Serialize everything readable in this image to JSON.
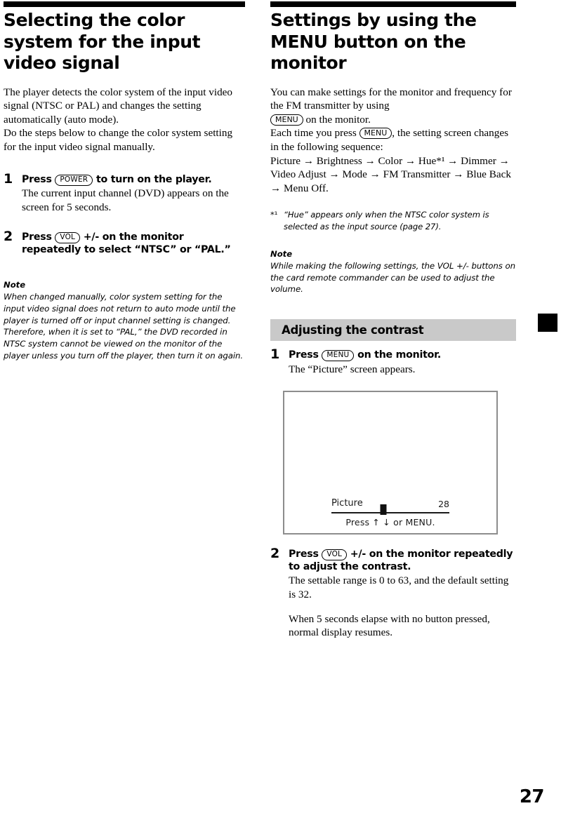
{
  "page": {
    "folio": "27"
  },
  "left_column": {
    "heading": "Selecting the color system for the input video signal",
    "intro": "The player detects the color system of the input video signal (NTSC or PAL) and changes the setting automatically (auto mode).\nDo the steps below to change the color system setting for the input video signal manually.",
    "steps": [
      {
        "number": "1",
        "title_before": "Press",
        "key": "POWER",
        "title_after": "to turn on the player.",
        "description": "The current input channel (DVD) appears on the screen for 5 seconds."
      },
      {
        "number": "2",
        "title_before": "Press",
        "key": "VOL",
        "title_after": "+/- on the monitor repeatedly to select “NTSC” or “PAL.”",
        "description": ""
      }
    ],
    "note": {
      "title": "Note",
      "body": "When changed manually, color system setting for the input video signal does not return to auto mode until the player is turned off or input channel setting is changed. Therefore, when it is set to “PAL,” the DVD recorded in NTSC system cannot be viewed on the monitor of the player unless you turn off the player, then turn it on again."
    }
  },
  "right_column": {
    "heading": "Settings by using the MENU button on the monitor",
    "intro_line1": "You can make settings for the monitor and frequency for the FM transmitter by using",
    "intro_key": "MENU",
    "intro_line2": "on the monitor.",
    "sequence_lead1": "Each time you press",
    "sequence_key": "MENU",
    "sequence_lead2": ", the setting screen changes in the following sequence:",
    "sequence": [
      "Picture",
      "Brightness",
      "Color",
      "Hue*1",
      "Dimmer",
      "Video Adjust",
      "Mode",
      "FM Transmitter",
      "Blue Back",
      "Menu Off."
    ],
    "sequence_text": "Picture → Brightness →  Color → Hue*¹ → Dimmer → Video Adjust → Mode → FM Transmitter → Blue Back  → Menu Off.",
    "footnote": {
      "mark": "*¹",
      "text": "“Hue” appears only when the NTSC color system is selected as the input source (page 27)."
    },
    "note": {
      "title": "Note",
      "body": "While making the following settings, the VOL +/- buttons on the card remote commander can be used to adjust the volume."
    },
    "section_heading": "Adjusting the contrast",
    "steps": [
      {
        "number": "1",
        "title_before": "Press",
        "key": "MENU",
        "title_after": "on the monitor.",
        "description": "The “Picture” screen appears."
      },
      {
        "number": "2",
        "title_before": "Press",
        "key": "VOL",
        "title_after": "+/- on the monitor repeatedly to adjust the contrast.",
        "description": "The settable range is 0 to 63, and the default setting is 32.",
        "description2": "When 5 seconds elapse with no button pressed, normal display resumes."
      }
    ],
    "screen_osd": {
      "label": "Picture",
      "value": "28",
      "slider_percent": "44",
      "hint": "Press ↑ ↓ or MENU."
    }
  },
  "colors": {
    "rule": "#000000",
    "section_bar": "#c9c9c9",
    "screen_border": "#8d8d8d",
    "edge_tab": "#000000"
  }
}
